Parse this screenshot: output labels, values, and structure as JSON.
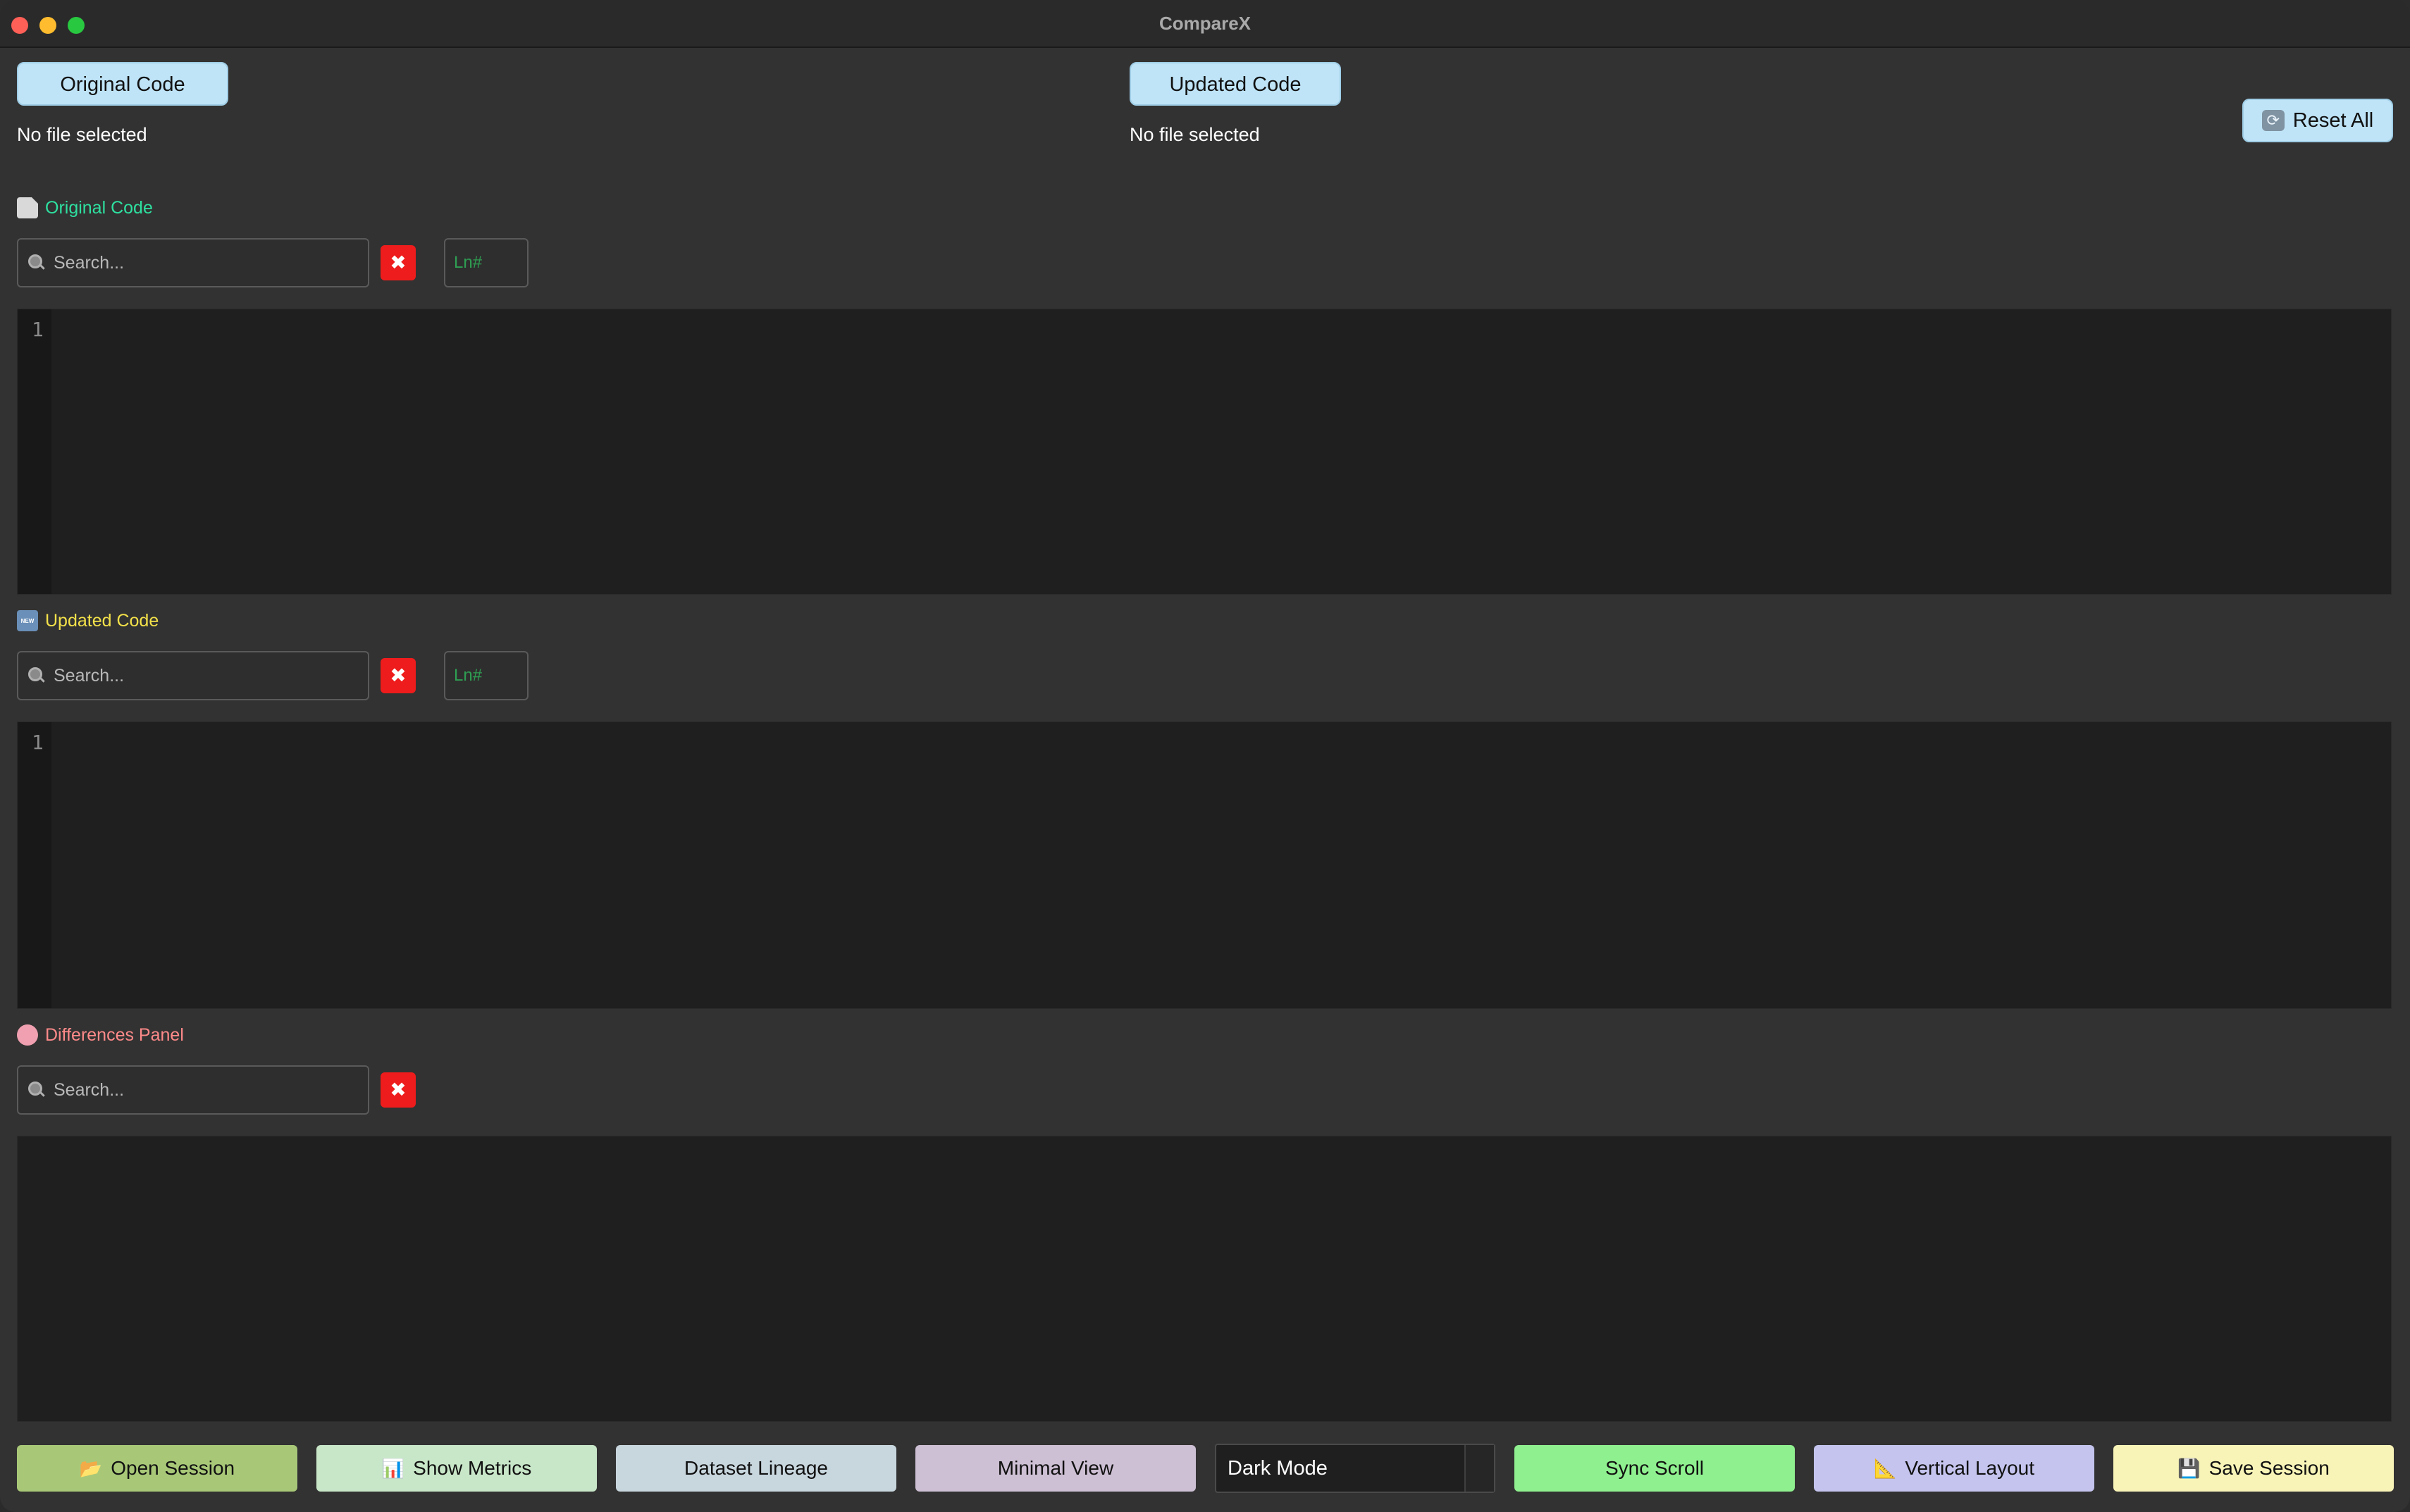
{
  "window": {
    "title": "CompareX"
  },
  "file_select": {
    "original_button": "Original Code",
    "original_status": "No file selected",
    "updated_button": "Updated Code",
    "updated_status": "No file selected",
    "reset_button": "Reset All",
    "reset_icon": "refresh-icon"
  },
  "panels": {
    "original": {
      "title": "Original Code",
      "title_color": "#2ee0a0",
      "icon": "document-icon",
      "search_placeholder": "Search...",
      "clear_label": "✖",
      "line_placeholder": "Ln#",
      "line_numbers": [
        "1"
      ]
    },
    "updated": {
      "title": "Updated Code",
      "title_color": "#f3e14a",
      "icon": "new-badge-icon",
      "icon_text": "NEW",
      "search_placeholder": "Search...",
      "clear_label": "✖",
      "line_placeholder": "Ln#",
      "line_numbers": [
        "1"
      ]
    },
    "differences": {
      "title": "Differences Panel",
      "title_color": "#ff8a8a",
      "icon": "brain-icon",
      "search_placeholder": "Search...",
      "clear_label": "✖"
    }
  },
  "bottom_bar": {
    "open_session": {
      "label": "Open Session",
      "icon": "folder-icon",
      "icon_glyph": "📂",
      "color": "#a8c878"
    },
    "show_metrics": {
      "label": "Show Metrics",
      "icon": "bar-chart-icon",
      "icon_glyph": "📊",
      "color": "#c8e6c8"
    },
    "dataset_lineage": {
      "label": "Dataset Lineage",
      "color": "#c8d6de"
    },
    "minimal_view": {
      "label": "Minimal View",
      "color": "#cdbfd4"
    },
    "theme_select": {
      "value": "Dark Mode"
    },
    "sync_scroll": {
      "label": "Sync Scroll",
      "color": "#8ff08f"
    },
    "vertical_layout": {
      "label": "Vertical Layout",
      "icon": "triangle-ruler-icon",
      "icon_glyph": "📐",
      "color": "#c4c4ee"
    },
    "save_session": {
      "label": "Save Session",
      "icon": "floppy-disk-icon",
      "icon_glyph": "💾",
      "color": "#f8f4b8"
    }
  }
}
